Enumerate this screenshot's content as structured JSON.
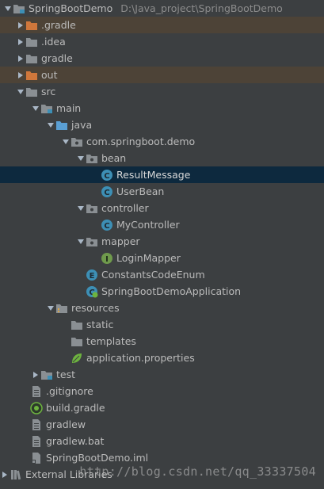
{
  "colors": {
    "background": "#3c3f41",
    "selected_row": "#0d293e",
    "excluded_row": "#4d4337",
    "folder": "#8a8f93",
    "source_folder": "#5a9fd4",
    "excluded_folder": "#d0773b",
    "class_icon": "#3d8fb5",
    "interface_icon": "#6f9a4c",
    "enum_icon": "#3d8fb5"
  },
  "tree": {
    "project_name": "SpringBootDemo",
    "project_path": "D:\\Java_project\\SpringBootDemo",
    "items": [
      {
        "label": "SpringBootDemo"
      },
      {
        "label": ".gradle"
      },
      {
        "label": ".idea"
      },
      {
        "label": "gradle"
      },
      {
        "label": "out"
      },
      {
        "label": "src"
      },
      {
        "label": "main"
      },
      {
        "label": "java"
      },
      {
        "label": "com.springboot.demo"
      },
      {
        "label": "bean"
      },
      {
        "label": "ResultMessage"
      },
      {
        "label": "UserBean"
      },
      {
        "label": "controller"
      },
      {
        "label": "MyController"
      },
      {
        "label": "mapper"
      },
      {
        "label": "LoginMapper"
      },
      {
        "label": "ConstantsCodeEnum"
      },
      {
        "label": "SpringBootDemoApplication"
      },
      {
        "label": "resources"
      },
      {
        "label": "static"
      },
      {
        "label": "templates"
      },
      {
        "label": "application.properties"
      },
      {
        "label": "test"
      },
      {
        "label": ".gitignore"
      },
      {
        "label": "build.gradle"
      },
      {
        "label": "gradlew"
      },
      {
        "label": "gradlew.bat"
      },
      {
        "label": "SpringBootDemo.iml"
      },
      {
        "label": "External Libraries"
      }
    ]
  },
  "watermark": "http://blog.csdn.net/qq_33337504"
}
